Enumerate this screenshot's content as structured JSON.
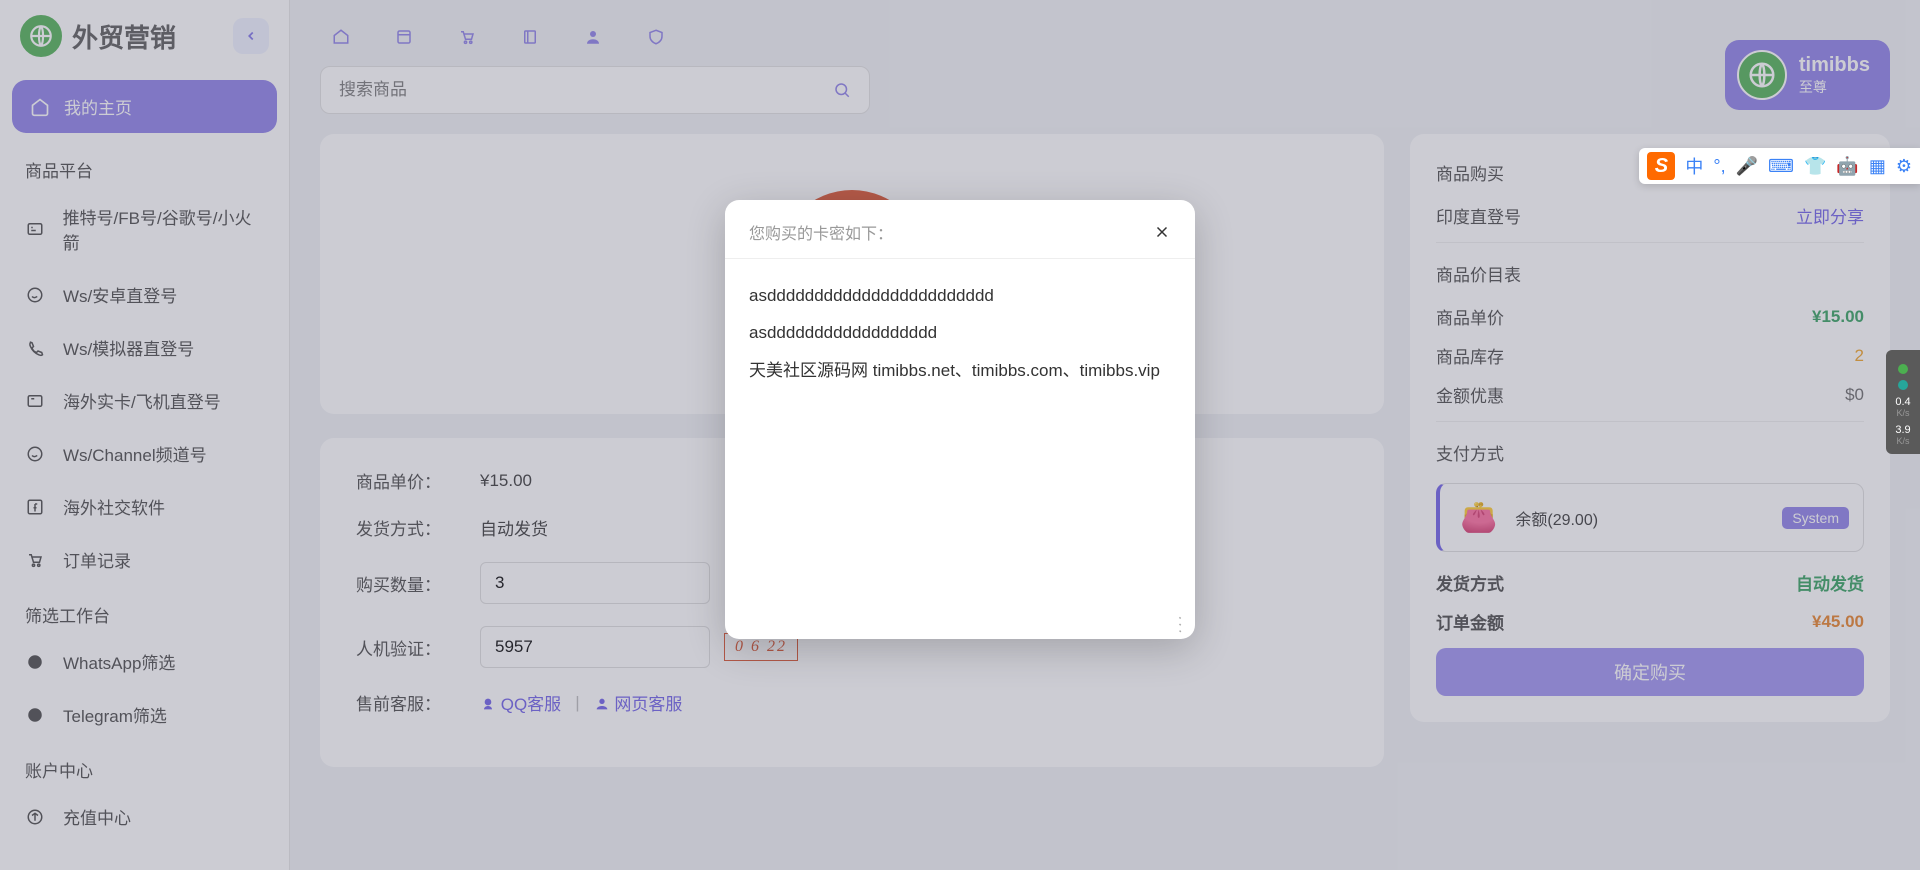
{
  "logo": {
    "title": "外贸营销"
  },
  "sidebar": {
    "active": {
      "label": "我的主页"
    },
    "sections": [
      {
        "title": "商品平台",
        "items": [
          {
            "label": "推特号/FB号/谷歌号/小火箭",
            "icon": "chat"
          },
          {
            "label": "Ws/安卓直登号",
            "icon": "whatsapp"
          },
          {
            "label": "Ws/模拟器直登号",
            "icon": "phone"
          },
          {
            "label": "海外实卡/飞机直登号",
            "icon": "card"
          },
          {
            "label": "Ws/Channel频道号",
            "icon": "whatsapp"
          },
          {
            "label": "海外社交软件",
            "icon": "fb"
          },
          {
            "label": "订单记录",
            "icon": "cart"
          }
        ]
      },
      {
        "title": "筛选工作台",
        "items": [
          {
            "label": "WhatsApp筛选",
            "icon": "whatsapp"
          },
          {
            "label": "Telegram筛选",
            "icon": "telegram"
          }
        ]
      },
      {
        "title": "账户中心",
        "items": [
          {
            "label": "充值中心",
            "icon": "recharge"
          }
        ]
      }
    ]
  },
  "search": {
    "placeholder": "搜索商品"
  },
  "user": {
    "name": "timibbs",
    "rank": "至尊"
  },
  "order": {
    "unit_price_label": "商品单价：",
    "unit_price": "¥15.00",
    "delivery_label": "发货方式：",
    "delivery": "自动发货",
    "qty_label": "购买数量：",
    "qty": "3",
    "captcha_label": "人机验证：",
    "captcha_val": "5957",
    "captcha_img": "0 6 22",
    "service_label": "售前客服：",
    "qq_service": "QQ客服",
    "web_service": "网页客服"
  },
  "panel": {
    "purchase": "商品购买",
    "product_name": "印度直登号",
    "share": "立即分享",
    "pricing_title": "商品价目表",
    "unit_price_lbl": "商品单价",
    "unit_price": "¥15.00",
    "stock_lbl": "商品库存",
    "stock": "2",
    "discount_lbl": "金额优惠",
    "discount": "$0",
    "payment_title": "支付方式",
    "balance_label": "余额(29.00)",
    "badge": "System",
    "ship_lbl": "发货方式",
    "ship_val": "自动发货",
    "total_lbl": "订单金额",
    "total_val": "¥45.00",
    "confirm": "确定购买"
  },
  "modal": {
    "title": "您购买的卡密如下：",
    "line1": "asdddddddddddddddddddddddd",
    "line2": "asdddddddddddddddddd",
    "line3": "天美社区源码网 timibbs.net、timibbs.com、timibbs.vip"
  },
  "ime": {
    "lang": "中"
  },
  "speed": {
    "up": "0.4",
    "up_unit": "K/s",
    "down": "3.9",
    "down_unit": "K/s"
  }
}
